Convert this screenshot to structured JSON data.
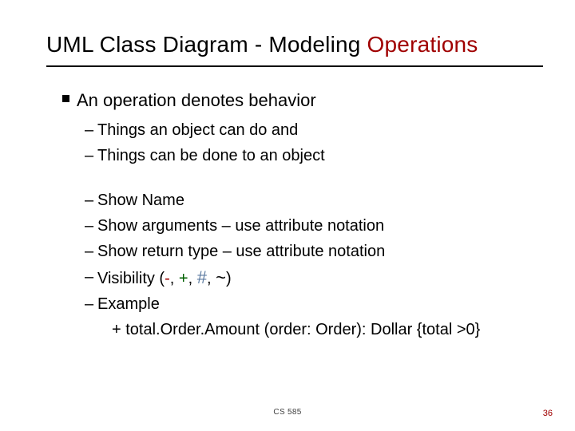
{
  "title": {
    "plain": "UML Class Diagram - Modeling ",
    "accent": "Operations"
  },
  "bullets": {
    "main": "An operation denotes behavior",
    "sub1": "Things an object can do and",
    "sub2": "Things can be done to an object",
    "sub3": "Show Name",
    "sub4": "Show arguments – use attribute notation",
    "sub5": "Show return type – use attribute notation",
    "vis_prefix": "Visibility (",
    "vis_minus": "-",
    "vis_sep1": ", ",
    "vis_plus": "+",
    "vis_sep2": ", ",
    "vis_hash": "#",
    "vis_sep3": ", ",
    "vis_tilde": "~",
    "vis_suffix": ")",
    "sub7": "Example",
    "example": "+ total.Order.Amount (order: Order): Dollar {total >0}"
  },
  "footer": {
    "course": "CS 585",
    "page": "36"
  }
}
